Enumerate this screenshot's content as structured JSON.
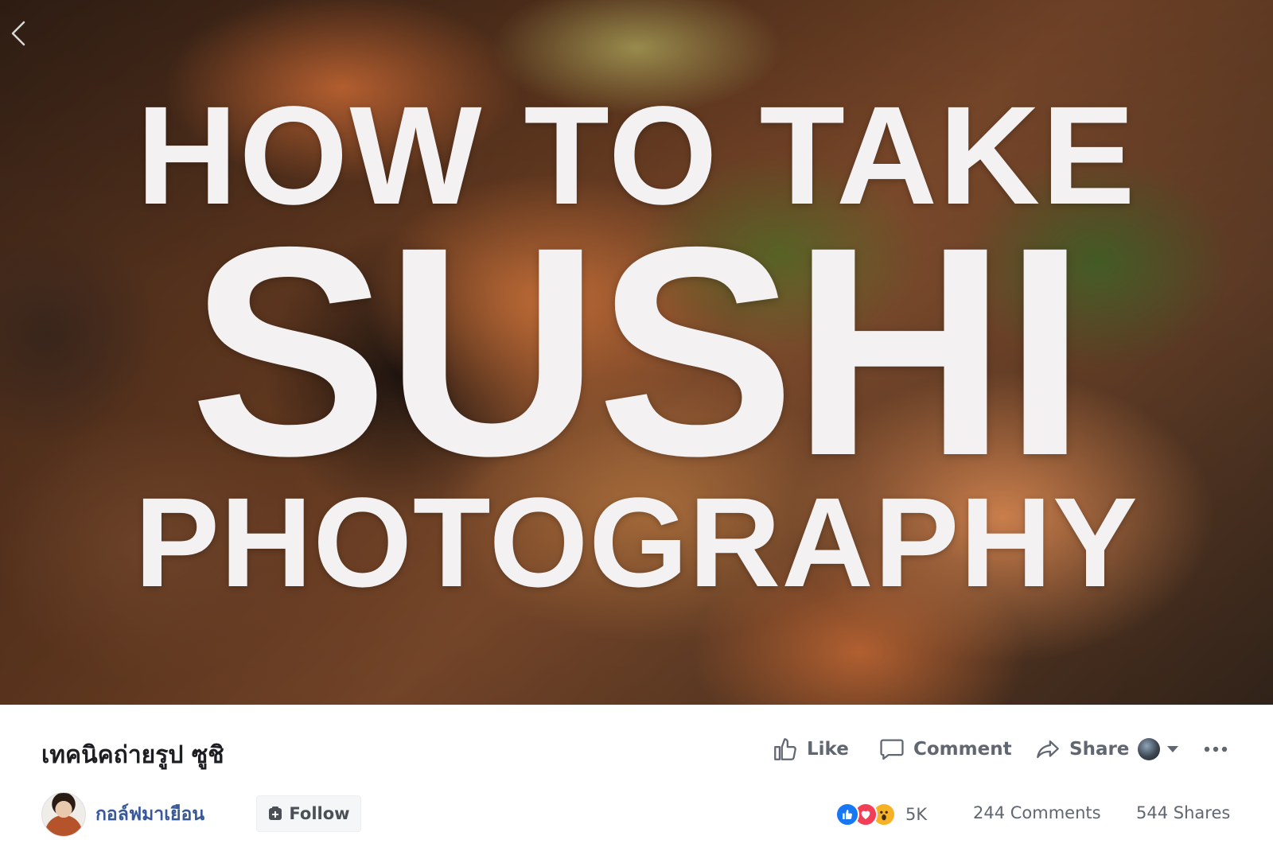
{
  "video": {
    "overlay_line1": "HOW TO TAKE",
    "overlay_line2": "SUSHI",
    "overlay_line3": "PHOTOGRAPHY"
  },
  "post": {
    "title": "เทคนิคถ่ายรูป ซูชิ",
    "author_name": "กอล์ฟมาเยือน",
    "follow_label": "Follow"
  },
  "actions": {
    "like_label": "Like",
    "comment_label": "Comment",
    "share_label": "Share"
  },
  "stats": {
    "reactions_count": "5K",
    "comments": "244 Comments",
    "shares": "544 Shares"
  },
  "icons": {
    "back": "chevron-left-icon",
    "like": "thumbs-up-icon",
    "comment": "speech-bubble-icon",
    "share": "share-arrow-icon",
    "audience": "caret-down-icon",
    "more": "ellipsis-icon",
    "follow": "follow-plus-icon",
    "reactions": [
      "like-reaction-icon",
      "love-reaction-icon",
      "wow-reaction-icon"
    ]
  },
  "colors": {
    "link_blue": "#385898",
    "action_gray": "#606770",
    "like_blue": "#1877f2",
    "love_red": "#f33e58",
    "wow_yellow": "#f7b125"
  }
}
